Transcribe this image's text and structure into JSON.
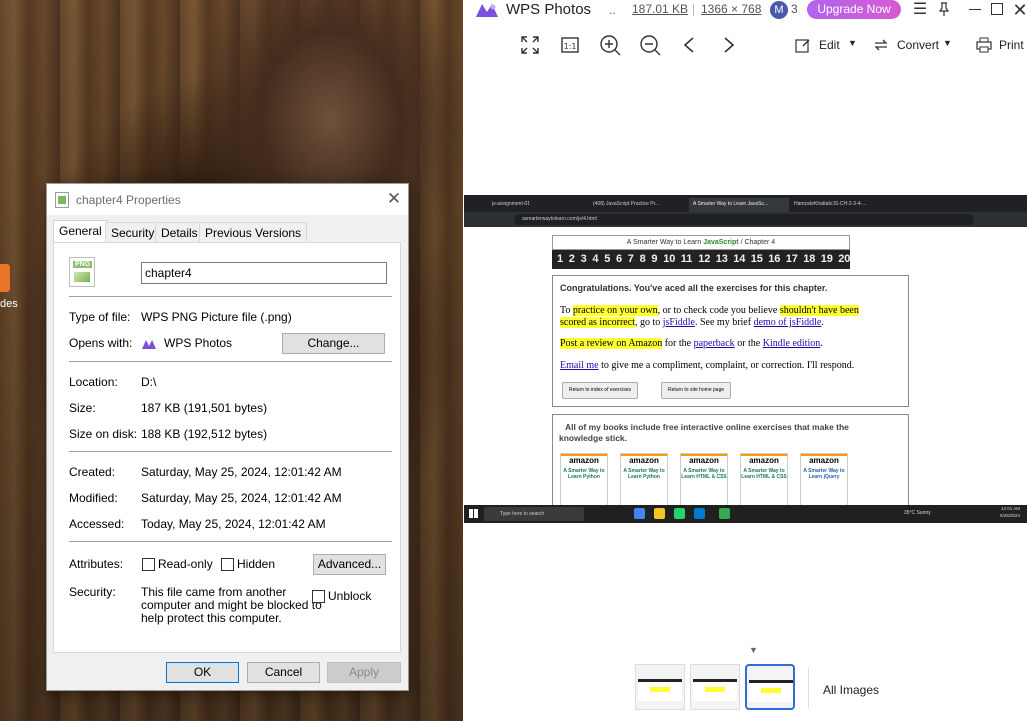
{
  "dialog": {
    "title": "chapter4 Properties",
    "close_glyph": "✕",
    "tabs": [
      "General",
      "Security",
      "Details",
      "Previous Versions"
    ],
    "file_name": "chapter4",
    "icon_badge": "PNG",
    "rows": {
      "type_label": "Type of file:",
      "type_value": "WPS PNG Picture file (.png)",
      "opens_label": "Opens with:",
      "opens_value": "WPS Photos",
      "change_btn": "Change...",
      "location_label": "Location:",
      "location_value": "D:\\",
      "size_label": "Size:",
      "size_value": "187 KB (191,501 bytes)",
      "sizeondisk_label": "Size on disk:",
      "sizeondisk_value": "188 KB (192,512 bytes)",
      "created_label": "Created:",
      "created_value": "Saturday, May 25, 2024, 12:01:42 AM",
      "modified_label": "Modified:",
      "modified_value": "Saturday, May 25, 2024, 12:01:42 AM",
      "accessed_label": "Accessed:",
      "accessed_value": "Today, May 25, 2024, 12:01:42 AM",
      "attributes_label": "Attributes:",
      "readonly": "Read-only",
      "hidden": "Hidden",
      "advanced_btn": "Advanced...",
      "security_label": "Security:",
      "security_text_1": "This file came from another",
      "security_text_2": "computer and might be blocked to",
      "security_text_3": "help protect this computer.",
      "unblock": "Unblock"
    },
    "buttons": {
      "ok": "OK",
      "cancel": "Cancel",
      "apply": "Apply"
    }
  },
  "desktop": {
    "icon_label": "des"
  },
  "wps": {
    "app_name": "WPS Photos",
    "dots": "..",
    "file_size": "187.01 KB",
    "dimensions": "1366 × 768",
    "avatar_letter": "M",
    "badge_count": "3",
    "upgrade": "Upgrade Now",
    "toolbar": {
      "edit": "Edit",
      "convert": "Convert",
      "print": "Print"
    },
    "all_images": "All Images",
    "colors": {
      "upgrade_start": "#b064ee",
      "upgrade_end": "#d85ad0",
      "accent": "#2c6fd8"
    }
  },
  "browser": {
    "tabs": [
      "js-assignment-01",
      "(408) JavaScript Practice Pr...",
      "A Smarter Way to Learn JavaSc...",
      "HamzaIeKhattak/JS-CH-2-3-4-..."
    ],
    "url": "asmarterwaytolearn.com/js/4.html",
    "site_header_pre": "A Smarter Way to Learn",
    "site_header_js": "JavaScript",
    "site_header_post": "/  Chapter 4",
    "chapters": [
      "1",
      "2",
      "3",
      "4",
      "5",
      "6",
      "7",
      "8",
      "9",
      "10",
      "11",
      "12",
      "13",
      "14",
      "15",
      "16",
      "17",
      "18",
      "19",
      "20"
    ],
    "congrats": "Congratulations. You've aced all the exercises for this chapter.",
    "p1_a": "To ",
    "p1_hl1": "practice on your own",
    "p1_b": ", or to check code you believe ",
    "p1_hl2": "shouldn't have been",
    "p1_hl3": "scored as incorrect",
    "p1_c": ", go to ",
    "p1_link1": "jsFiddle",
    "p1_d": ". See my brief ",
    "p1_link2": "demo of jsFiddle",
    "p1_e": ".",
    "p2_hl": "Post a review on Amazon",
    "p2_a": " for the ",
    "p2_link1": "paperback",
    "p2_b": " or the ",
    "p2_link2": "Kindle edition",
    "p2_c": ".",
    "p3_link": "Email me",
    "p3_a": " to give me a compliment, complaint, or correction. I'll respond.",
    "btn_index": "Return to index of exercises",
    "btn_home": "Return to site home page",
    "books_text_1": "All of my books include free interactive online exercises that make the",
    "books_text_2": "knowledge stick.",
    "book_brand": "amazon",
    "book_titles": [
      "A Smarter Way to Learn Python",
      "A Smarter Way to Learn Python",
      "A Smarter Way to Learn HTML & CSS",
      "A Smarter Way to Learn HTML & CSS",
      "A Smarter Way to Learn jQuery"
    ],
    "search_placeholder": "Type here to search",
    "weather": "35°C  Sunny",
    "time": "12:01 AM",
    "date": "5/25/2024"
  }
}
